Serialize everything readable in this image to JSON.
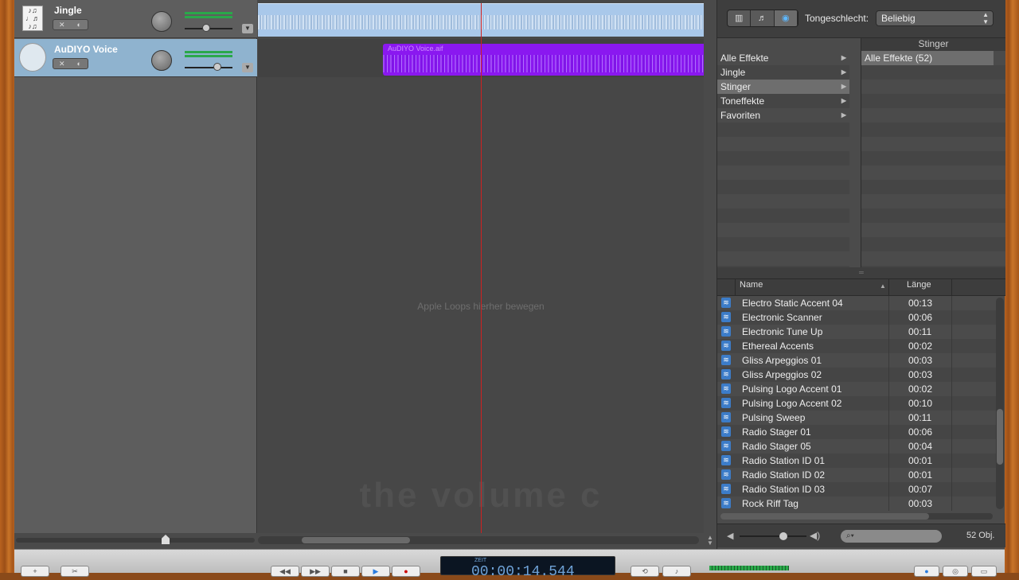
{
  "tracks": [
    {
      "name": "Jingle",
      "icon": "score-icon"
    },
    {
      "name": "AuDIYO Voice",
      "icon": "speaker-icon"
    }
  ],
  "arrange": {
    "voice_region_label": "AuDIYO Voice.aif",
    "drop_hint": "Apple Loops hierher bewegen",
    "ghost_text": "the volume c"
  },
  "browser": {
    "view_buttons": [
      "column-view-icon",
      "music-note-icon",
      "podcast-icon"
    ],
    "gender_label": "Tongeschlecht:",
    "gender_value": "Beliebig",
    "column_header": "Stinger",
    "categories": [
      {
        "label": "Alle Effekte",
        "selected": false
      },
      {
        "label": "Jingle",
        "selected": false
      },
      {
        "label": "Stinger",
        "selected": true
      },
      {
        "label": "Toneffekte",
        "selected": false
      },
      {
        "label": "Favoriten",
        "selected": false
      }
    ],
    "subcategory": "Alle Effekte (52)",
    "list_headers": {
      "name": "Name",
      "length": "Länge"
    },
    "rows": [
      {
        "name": "Electro Static Accent 04",
        "length": "00:13"
      },
      {
        "name": "Electronic Scanner",
        "length": "00:06"
      },
      {
        "name": "Electronic Tune Up",
        "length": "00:11"
      },
      {
        "name": "Ethereal Accents",
        "length": "00:02"
      },
      {
        "name": "Gliss Arpeggios 01",
        "length": "00:03"
      },
      {
        "name": "Gliss Arpeggios 02",
        "length": "00:03"
      },
      {
        "name": "Pulsing Logo Accent 01",
        "length": "00:02"
      },
      {
        "name": "Pulsing Logo Accent 02",
        "length": "00:10"
      },
      {
        "name": "Pulsing Sweep",
        "length": "00:11"
      },
      {
        "name": "Radio Stager 01",
        "length": "00:06"
      },
      {
        "name": "Radio Stager 05",
        "length": "00:04"
      },
      {
        "name": "Radio Station ID 01",
        "length": "00:01"
      },
      {
        "name": "Radio Station ID 02",
        "length": "00:01"
      },
      {
        "name": "Radio Station ID 03",
        "length": "00:07"
      },
      {
        "name": "Rock Riff Tag",
        "length": "00:03"
      }
    ],
    "count": "52 Obj."
  },
  "transport": {
    "lcd_label": "ZEIT",
    "time": "00:00:14.544"
  },
  "colors": {
    "jingle_region": "#a9c8ea",
    "voice_region": "#8a18f0",
    "playhead": "#d02020",
    "selected_track": "#8fb3cf"
  }
}
